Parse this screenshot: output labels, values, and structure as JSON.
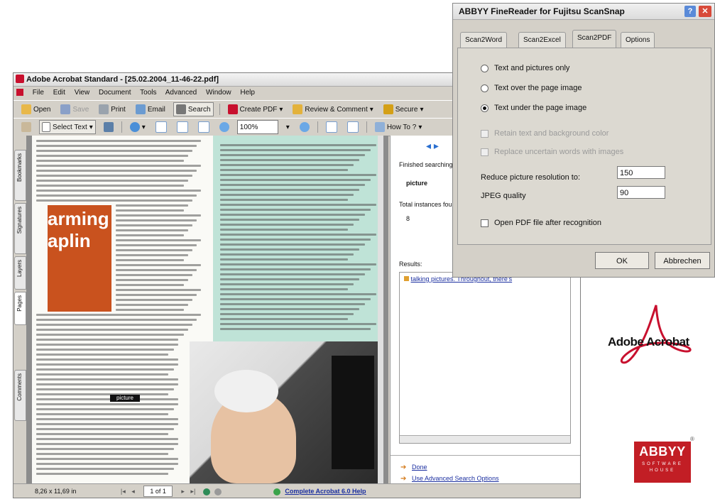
{
  "acrobat": {
    "title": "Adobe Acrobat Standard - [25.02.2004_11-46-22.pdf]",
    "menu": [
      "File",
      "Edit",
      "View",
      "Document",
      "Tools",
      "Advanced",
      "Window",
      "Help"
    ],
    "toolbar1": {
      "open": "Open",
      "save": "Save",
      "print": "Print",
      "email": "Email",
      "search": "Search",
      "create_pdf": "Create PDF",
      "review": "Review & Comment",
      "secure": "Secure"
    },
    "toolbar2": {
      "select_text": "Select Text",
      "zoom": "100%",
      "howto": "How To ?"
    },
    "side_tabs": [
      "Bookmarks",
      "Signatures",
      "Layers",
      "Pages",
      "Comments"
    ],
    "status": {
      "page_size": "8,26 x 11,69 in",
      "page_indicator": "1 of 1"
    },
    "doc": {
      "big_word_1": "arming",
      "big_word_2": "aplin",
      "highlight_word": "picture"
    }
  },
  "search_panel": {
    "finished_label": "Finished searching",
    "search_term": "picture",
    "total_label": "Total instances fou",
    "total_value": "8",
    "results_label": "Results:",
    "result_item": "talking pictures. Throughout, there's",
    "links": {
      "done": "Done",
      "advanced": "Use Advanced Search Options",
      "help": "Complete Acrobat 6.0 Help"
    }
  },
  "abbyy_dialog": {
    "title": "ABBYY FineReader for Fujitsu ScanSnap",
    "tabs": [
      "Scan2Word",
      "Scan2Excel",
      "Scan2PDF",
      "Options"
    ],
    "active_tab": "Scan2PDF",
    "radio_options": [
      "Text and pictures only",
      "Text over the page image",
      "Text under the page image"
    ],
    "selected_option": "Text under the page image",
    "disabled_checks": [
      "Retain text and background color",
      "Replace uncertain words with images"
    ],
    "resolution_label": "Reduce picture resolution to:",
    "resolution_value": "150",
    "jpeg_label": "JPEG quality",
    "jpeg_value": "90",
    "open_pdf_label": "Open PDF file after recognition",
    "ok": "OK",
    "cancel": "Abbrechen"
  },
  "logos": {
    "acrobat": "Adobe Acrobat",
    "abbyy": "ABBYY",
    "abbyy_sub_1": "SOFTWARE",
    "abbyy_sub_2": "HOUSE"
  },
  "colors": {
    "acrobat_red": "#c8102e",
    "abbyy_red": "#c21e25",
    "doc_orange": "#c9521e",
    "doc_teal": "#bfe3d7"
  }
}
